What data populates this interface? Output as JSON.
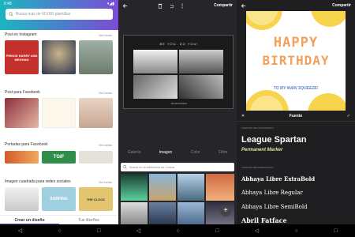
{
  "status": {
    "time": "6:48",
    "icons": "▾◢▮"
  },
  "home": {
    "search_placeholder": "Busca más de 60.000 plantillas",
    "see_all": "Ver todos",
    "sections": [
      {
        "title": "Post en Instagram",
        "thumbs": [
          "PRINCE HARRY AND MEGHAN",
          "",
          ""
        ]
      },
      {
        "title": "Post para Facebook",
        "thumbs": [
          "",
          "",
          ""
        ]
      },
      {
        "title": "Portadas para Facebook",
        "thumbs": [
          "",
          "TGIF",
          ""
        ]
      },
      {
        "title": "Imagen cuadrada para redes sociales",
        "thumbs": [
          "",
          "SURFING",
          "THE CLOCK"
        ]
      }
    ],
    "tabs": {
      "create": "Crear un diseño",
      "yours": "Tus diseños"
    }
  },
  "editor": {
    "share": "Compartir",
    "canvas_title": "BE YOU. DO YOU!",
    "canvas_footer": "#CLIFFSTMAX",
    "tabs": [
      "Galería",
      "Imagen",
      "Color",
      "Filtro"
    ],
    "active_tab": "Imagen",
    "search_placeholder": "Busca en la biblioteca de Canva"
  },
  "fonts": {
    "share": "Compartir",
    "card_line1": "HAPPY",
    "card_line2": "BIRTHDAY",
    "card_sub": "TO MY MAIN SQUEEZE!",
    "bar_label": "Fuente",
    "doc_label": "FUENTES DEL DOCUMENTO",
    "doc_fonts": [
      "League Spartan",
      "Permanent Marker"
    ],
    "rec_label": "FUENTES RECOMENDADAS",
    "options": [
      "Abhaya Libre ExtraBold",
      "Abhaya Libre Regular",
      "Abhaya Libre SemiBold",
      "Abril Fatface"
    ]
  },
  "nav": {
    "back": "◁",
    "home": "○",
    "recent": "□"
  },
  "colors": {
    "brand_start": "#1bb5c0",
    "brand_end": "#7a4cd6",
    "accent_orange": "#f2a05a",
    "accent_blue": "#5a89c9"
  }
}
